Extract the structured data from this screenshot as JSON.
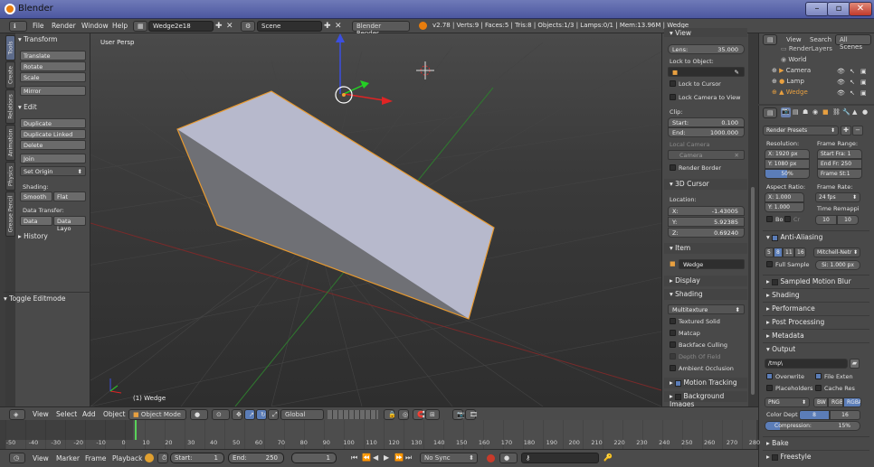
{
  "window": {
    "title": "Blender"
  },
  "topbar": {
    "menus": [
      "File",
      "Render",
      "Window",
      "Help"
    ],
    "screen": "Wedge2e18",
    "scene": "Scene",
    "engine": "Blender Render",
    "stats": "v2.78 | Verts:9 | Faces:5 | Tris:8 | Objects:1/3 | Lamps:0/1 | Mem:13.96M | Wedge"
  },
  "tabs": [
    "Tools",
    "Create",
    "Relations",
    "Animation",
    "Physics",
    "Grease Pencil"
  ],
  "shelf": {
    "transform_title": "Transform",
    "translate": "Translate",
    "rotate": "Rotate",
    "scale": "Scale",
    "mirror": "Mirror",
    "edit_title": "Edit",
    "duplicate": "Duplicate",
    "duplicate_linked": "Duplicate Linked",
    "delete": "Delete",
    "join": "Join",
    "set_origin": "Set Origin",
    "shading_label": "Shading:",
    "smooth": "Smooth",
    "flat": "Flat",
    "data_transfer_label": "Data Transfer:",
    "data": "Data",
    "data_layo": "Data Layo",
    "history_title": "History",
    "toggle_editmode": "Toggle Editmode"
  },
  "viewport": {
    "label": "User Persp",
    "object_label": "(1) Wedge"
  },
  "npanel": {
    "view_title": "View",
    "lens_label": "Lens:",
    "lens_value": "35.000",
    "lock_to_object": "Lock to Object:",
    "lock_to_cursor": "Lock to Cursor",
    "lock_camera": "Lock Camera to View",
    "clip_label": "Clip:",
    "clip_start_label": "Start:",
    "clip_start": "0.100",
    "clip_end_label": "End:",
    "clip_end": "1000.000",
    "local_camera": "Local Camera",
    "camera_field": "Camera",
    "render_border": "Render Border",
    "cursor_title": "3D Cursor",
    "location_label": "Location:",
    "x_label": "X:",
    "x_value": "-1.43005",
    "y_label": "Y:",
    "y_value": "5.92385",
    "z_label": "Z:",
    "z_value": "0.69240",
    "item_title": "Item",
    "item_name": "Wedge",
    "display_title": "Display",
    "shading_title": "Shading",
    "multitexture": "Multitexture",
    "textured_solid": "Textured Solid",
    "matcap": "Matcap",
    "backface_culling": "Backface Culling",
    "depth_of_field": "Depth Of Field",
    "ambient_occlusion": "Ambient Occlusion",
    "motion_tracking": "Motion Tracking",
    "background_images": "Background Images"
  },
  "outliner": {
    "view": "View",
    "search": "Search",
    "all_scenes": "All Scenes",
    "items": [
      "RenderLayers",
      "World",
      "Camera",
      "Lamp",
      "Wedge"
    ]
  },
  "props": {
    "render_presets": "Render Presets",
    "resolution_label": "Resolution:",
    "frame_range_label": "Frame Range:",
    "res_x": "X: 1920 px",
    "res_y": "Y: 1080 px",
    "res_pct": "50%",
    "start_frame": "Start Fra: 1",
    "end_frame": "End Fr: 250",
    "frame_step": "Frame St:1",
    "aspect_label": "Aspect Ratio:",
    "frame_rate_label": "Frame Rate:",
    "aspect_x": "X: 1.000",
    "aspect_y": "Y: 1.000",
    "fps": "24 fps",
    "time_remap": "Time Remappi",
    "remap_old": "10",
    "remap_new": "10",
    "bo": "Bo",
    "cr": "Cr",
    "anti_aliasing": "Anti-Aliasing",
    "aa_samples": [
      "5",
      "8",
      "11",
      "16"
    ],
    "filter": "Mitchell-Netr",
    "full_sample": "Full Sample",
    "filter_size": "Si: 1.000 px",
    "sampled_motion_blur": "Sampled Motion Blur",
    "shading": "Shading",
    "performance": "Performance",
    "post_processing": "Post Processing",
    "metadata": "Metadata",
    "output": "Output",
    "output_path": "/tmp\\",
    "overwrite": "Overwrite",
    "file_extensions": "File Exten",
    "placeholders": "Placeholders",
    "cache_result": "Cache Res",
    "format": "PNG",
    "bw": "BW",
    "rgb": "RGB",
    "rgba": "RGBA",
    "color_depth_label": "Color Dept",
    "depth_8": "8",
    "depth_16": "16",
    "compression": "Compression:",
    "compression_value": "15%",
    "compression_fraction": 0.15,
    "bake": "Bake",
    "freestyle": "Freestyle"
  },
  "view_header": {
    "view": "View",
    "select": "Select",
    "add": "Add",
    "object": "Object",
    "mode": "Object Mode",
    "orientation": "Global"
  },
  "timeline": {
    "ticks": [
      "-50",
      "-40",
      "-30",
      "-20",
      "-10",
      "0",
      "10",
      "20",
      "30",
      "40",
      "50",
      "60",
      "70",
      "80",
      "90",
      "100",
      "110",
      "120",
      "130",
      "140",
      "150",
      "160",
      "170",
      "180",
      "190",
      "200",
      "210",
      "220",
      "230",
      "240",
      "250",
      "260",
      "270",
      "280"
    ],
    "current_frame": 1
  },
  "timeline_header": {
    "view": "View",
    "marker": "Marker",
    "frame": "Frame",
    "playback": "Playback",
    "start_label": "Start:",
    "start": "1",
    "end_label": "End:",
    "end": "250",
    "current": "1",
    "sync": "No Sync"
  }
}
